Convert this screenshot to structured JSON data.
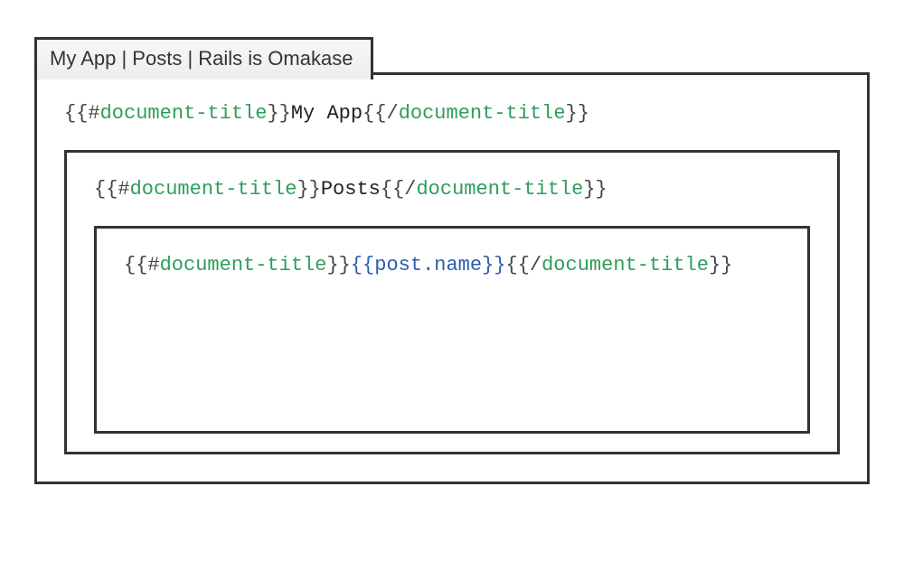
{
  "tab": {
    "title": "My App | Posts | Rails is Omakase"
  },
  "tokens": {
    "openHash": "{{#",
    "openSlash": "{{/",
    "open": "{{",
    "close": "}}",
    "helper": "document-title",
    "expr": "post.name"
  },
  "content": {
    "level0": "My App",
    "level1": "Posts"
  }
}
